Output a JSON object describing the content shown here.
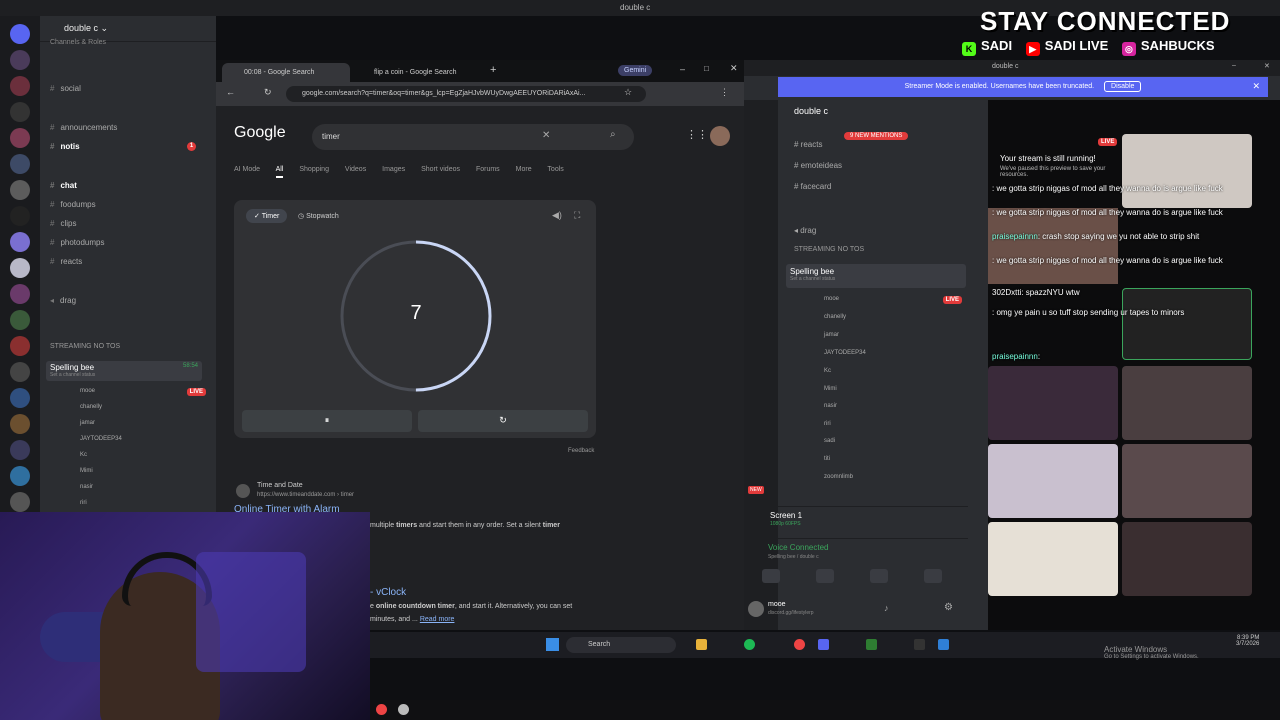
{
  "window_title": "double c",
  "discord_left": {
    "server_name": "double c",
    "channels_roles": "Channels & Roles",
    "channels": [
      {
        "name": "social",
        "mention": false
      },
      {
        "name": "announcements",
        "mention": false
      },
      {
        "name": "notis",
        "mention": true
      },
      {
        "name": "chat",
        "mention": false
      },
      {
        "name": "foodumps",
        "mention": false
      },
      {
        "name": "clips",
        "mention": false
      },
      {
        "name": "photodumps",
        "mention": false
      },
      {
        "name": "reacts",
        "mention": false
      }
    ],
    "drag": "drag",
    "category": "STREAMING NO TOS",
    "voice_channel": "Spelling bee",
    "voice_status": "Set a channel status",
    "voice_time": "58:54",
    "live_label": "LIVE",
    "members": [
      "mooe",
      "chanelly",
      "jamar",
      "JAYTODEEP34",
      "Kc",
      "Mimi",
      "nasir",
      "riri"
    ]
  },
  "chrome": {
    "tabs": [
      {
        "label": "00:08 - Google Search"
      },
      {
        "label": "flip a coin - Google Search"
      }
    ],
    "gemini": "Gemini",
    "url": "google.com/search?q=timer&oq=timer&gs_lcp=EgZjaHJvbWUyDwgAEEUYORiDARiAxAi...",
    "logo": "Google",
    "search_value": "timer",
    "search_tabs": [
      "AI Mode",
      "All",
      "Shopping",
      "Videos",
      "Images",
      "Short videos",
      "Forums",
      "More",
      "Tools"
    ],
    "timer_tab": "Timer",
    "stopwatch_tab": "Stopwatch",
    "countdown": "7",
    "timer_progress": 0.5,
    "feedback": "Feedback",
    "result1_source": "Time and Date",
    "result1_url": "https://www.timeanddate.com › timer",
    "result1_title": "Online Timer with Alarm",
    "result1_snippet_a": "multiple",
    "result1_snippet_b": "timers",
    "result1_snippet_c": "and start them in any order. Set a silent",
    "result1_snippet_d": "timer",
    "result2_title": "- vClock",
    "result2_snippet_a": "e",
    "result2_snippet_b": "online countdown timer",
    "result2_snippet_c": ", and start it. Alternatively, you can set",
    "result2_snippet_d": "minutes, and ...",
    "read_more": "Read more"
  },
  "discord_right": {
    "title": "double c",
    "banner": "Streamer Mode is enabled. Usernames have been truncated.",
    "disable": "Disable",
    "channels": [
      "reacts",
      "emoteideas",
      "facecard"
    ],
    "new_mentions": "9 NEW MENTIONS",
    "drag": "drag",
    "category": "STREAMING NO TOS",
    "voice_channel": "Spelling bee",
    "voice_status": "Set a channel status",
    "live_label": "LIVE",
    "members": [
      "mooe",
      "chanelly",
      "jamar",
      "JAYTODEEP34",
      "Kc",
      "Mimi",
      "nasir",
      "riri",
      "sadi",
      "titi",
      "zoomnlimb"
    ],
    "screen_label": "Screen 1",
    "screen_sub": "1080p 60FPS",
    "voice_connected": "Voice Connected",
    "voice_connected_sub": "Spelling bee / double c",
    "user_name": "mooe",
    "user_sub": "discord.gg/lifestylerp",
    "new_label": "NEW"
  },
  "stream": {
    "live_label": "LIVE",
    "notice_title": "Your stream is still running!",
    "notice_sub": "We've paused this preview to save your resources.",
    "chat": [
      {
        "user": "",
        "text": ": we gotta strip niggas of mod all they wanna do is argue like fuck"
      },
      {
        "user": "",
        "text": ": we gotta strip niggas of mod all they wanna do is argue like fuck"
      },
      {
        "user": "praisepainnn",
        "text": ": crash stop saying we yu not able to strip shit"
      },
      {
        "user": "",
        "text": ": we gotta strip niggas of mod all they wanna do is argue like fuck"
      },
      {
        "user": "302Dxtti",
        "text": ": spazzNYU wtw"
      },
      {
        "user": "",
        "text": ": omg ye pain u so tuff stop sending ur tapes to minors"
      },
      {
        "user": "praisepainnn",
        "text": ":"
      }
    ]
  },
  "taskbar": {
    "search": "Search",
    "activate_title": "Activate Windows",
    "activate_sub": "Go to Settings to activate Windows.",
    "time": "8:39 PM",
    "date": "3/7/2026"
  },
  "overlay": {
    "title": "STAY CONNECTED",
    "kick": "SADI",
    "youtube": "SADI LIVE",
    "instagram": "SAHBUCKS"
  }
}
